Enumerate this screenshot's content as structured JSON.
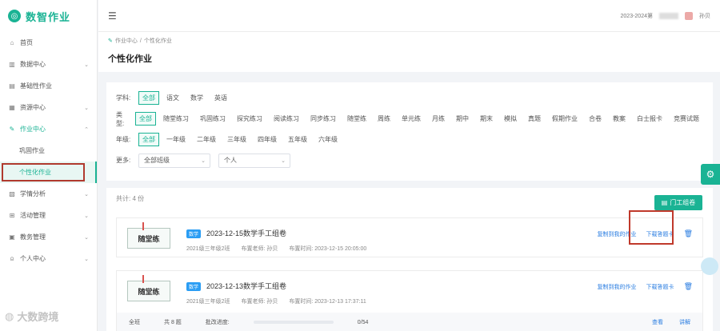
{
  "app": {
    "title": "数智作业"
  },
  "sidebar": {
    "items": [
      {
        "label": "首页",
        "icon": "home-icon"
      },
      {
        "label": "数据中心",
        "icon": "chart-icon",
        "expandable": true
      },
      {
        "label": "基础性作业",
        "icon": "doc-icon"
      },
      {
        "label": "资源中心",
        "icon": "grid-icon",
        "expandable": true
      },
      {
        "label": "作业中心",
        "icon": "edit-icon",
        "expandable": true,
        "open": true
      },
      {
        "label": "巩固作业",
        "sub": true
      },
      {
        "label": "个性化作业",
        "sub": true,
        "current": true
      },
      {
        "label": "学情分析",
        "icon": "analysis-icon",
        "expandable": true
      },
      {
        "label": "活动管理",
        "icon": "gift-icon",
        "expandable": true
      },
      {
        "label": "教务管理",
        "icon": "briefcase-icon",
        "expandable": true
      },
      {
        "label": "个人中心",
        "icon": "user-icon",
        "expandable": true
      }
    ]
  },
  "topbar": {
    "date": "2023-2024第",
    "user": "孙贝"
  },
  "breadcrumb": {
    "parent": "作业中心",
    "sep": "/",
    "current": "个性化作业"
  },
  "page": {
    "title": "个性化作业"
  },
  "filters": {
    "subject": {
      "label": "学科:",
      "options": [
        "全部",
        "语文",
        "数学",
        "英语"
      ],
      "selected": 0
    },
    "type": {
      "label": "类型:",
      "options": [
        "全部",
        "随堂练习",
        "巩固练习",
        "探究练习",
        "阅读练习",
        "同步练习",
        "随堂练",
        "周练",
        "单元练",
        "月练",
        "期中",
        "期末",
        "模拟",
        "真题",
        "假期作业",
        "合卷",
        "教案",
        "白士报卡",
        "竞赛试题"
      ],
      "selected": 0
    },
    "grade": {
      "label": "年级:",
      "options": [
        "全部",
        "一年级",
        "二年级",
        "三年级",
        "四年级",
        "五年级",
        "六年级"
      ],
      "selected": 0
    },
    "more": {
      "label": "更多:",
      "select1": "全部班级",
      "select2": "个人"
    }
  },
  "results": {
    "count": "共计: 4 份",
    "generate_button": "门工组卷",
    "cards": [
      {
        "cover": "随堂练",
        "tag": "数学",
        "title": "2023-12-15数学手工组卷",
        "class": "2021级三年级2班",
        "teacher": "布置老师: 孙贝",
        "time": "布置时间: 2023-12-15 20:05:00",
        "copy_action": "复制到我的作业",
        "download_action": "下载答题卡"
      },
      {
        "cover": "随堂练",
        "tag": "数学",
        "title": "2023-12-13数学手工组卷",
        "class": "2021级三年级2班",
        "teacher": "布置老师: 孙贝",
        "time": "布置时间: 2023-12-13 17:37:11",
        "copy_action": "复制到我的作业",
        "download_action": "下载答题卡",
        "stats": {
          "scope": "全班",
          "total": "共 8 题",
          "progress_label": "批改进度:",
          "progress_value": "0/54",
          "progress": 0.0,
          "view": "查看",
          "explain": "讲解"
        }
      }
    ]
  },
  "watermark": "大数跨境"
}
